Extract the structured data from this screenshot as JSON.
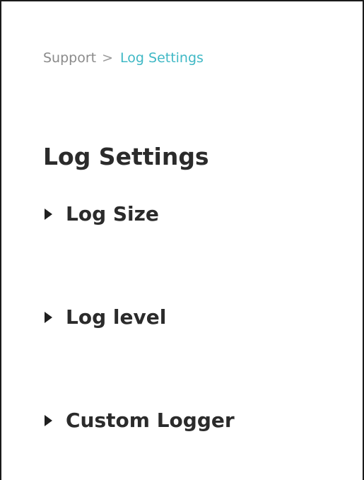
{
  "breadcrumb": {
    "parent": "Support",
    "separator": ">",
    "current": "Log Settings"
  },
  "page": {
    "title": "Log Settings"
  },
  "sections": [
    {
      "label": "Log Size",
      "icon": "caret-right-icon",
      "expanded": false
    },
    {
      "label": "Log level",
      "icon": "caret-right-icon",
      "expanded": false
    },
    {
      "label": "Custom Logger",
      "icon": "caret-right-icon",
      "expanded": false
    }
  ],
  "colors": {
    "breadcrumb_parent": "#8a8a8a",
    "breadcrumb_current": "#3fb8c5",
    "heading": "#2b2b2b",
    "caret": "#1f1f1f"
  }
}
